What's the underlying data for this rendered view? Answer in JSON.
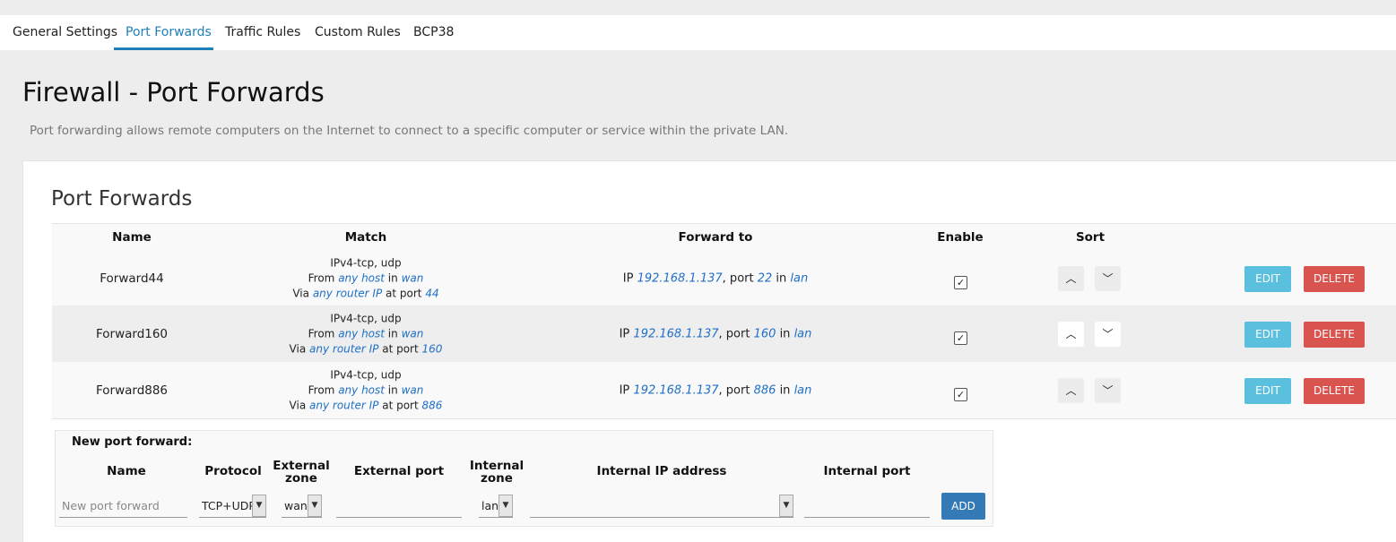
{
  "tabs": [
    {
      "label": "General Settings"
    },
    {
      "label": "Port Forwards",
      "active": true
    },
    {
      "label": "Traffic Rules"
    },
    {
      "label": "Custom Rules"
    },
    {
      "label": "BCP38"
    }
  ],
  "page": {
    "title": "Firewall - Port Forwards",
    "description": "Port forwarding allows remote computers on the Internet to connect to a specific computer or service within the private LAN."
  },
  "section": {
    "title": "Port Forwards"
  },
  "table": {
    "headers": [
      "Name",
      "Match",
      "Forward to",
      "Enable",
      "Sort"
    ],
    "rows": [
      {
        "name": "Forward44",
        "proto_line": "IPv4-tcp, udp",
        "from_prefix": "From",
        "from_host": "any host",
        "in_word": "in",
        "from_zone": "wan",
        "via_prefix": "Via",
        "via_host": "any router IP",
        "at_port_word": "at port",
        "ext_port": "44",
        "ip_word": "IP",
        "ip": "192.168.1.137",
        "port_word": ", port",
        "int_port": "22",
        "to_zone": "lan",
        "enabled": true
      },
      {
        "name": "Forward160",
        "proto_line": "IPv4-tcp, udp",
        "from_prefix": "From",
        "from_host": "any host",
        "in_word": "in",
        "from_zone": "wan",
        "via_prefix": "Via",
        "via_host": "any router IP",
        "at_port_word": "at port",
        "ext_port": "160",
        "ip_word": "IP",
        "ip": "192.168.1.137",
        "port_word": ", port",
        "int_port": "160",
        "to_zone": "lan",
        "enabled": true
      },
      {
        "name": "Forward886",
        "proto_line": "IPv4-tcp, udp",
        "from_prefix": "From",
        "from_host": "any host",
        "in_word": "in",
        "from_zone": "wan",
        "via_prefix": "Via",
        "via_host": "any router IP",
        "at_port_word": "at port",
        "ext_port": "886",
        "ip_word": "IP",
        "ip": "192.168.1.137",
        "port_word": ", port",
        "int_port": "886",
        "to_zone": "lan",
        "enabled": true
      }
    ],
    "edit_label": "EDIT",
    "delete_label": "DELETE",
    "check_glyph": "✓",
    "sort_up_icon": "chevron-up-icon",
    "sort_down_icon": "chevron-down-icon"
  },
  "new_forward": {
    "title": "New port forward:",
    "headers": {
      "name": "Name",
      "protocol": "Protocol",
      "external_zone_l1": "External",
      "external_zone_l2": "zone",
      "external_port": "External port",
      "internal_zone_l1": "Internal",
      "internal_zone_l2": "zone",
      "internal_ip": "Internal IP address",
      "internal_port": "Internal port"
    },
    "name_placeholder": "New port forward",
    "protocol_value": "TCP+UDP",
    "external_zone_value": "wan",
    "external_port_value": "",
    "internal_zone_value": "lan",
    "internal_ip_value": "",
    "internal_port_value": "",
    "add_label": "ADD"
  },
  "colors": {
    "accent": "#1f7fb8",
    "link": "#1f6fc6",
    "edit": "#5bc0de",
    "delete": "#d9534f",
    "add": "#337ab7"
  }
}
